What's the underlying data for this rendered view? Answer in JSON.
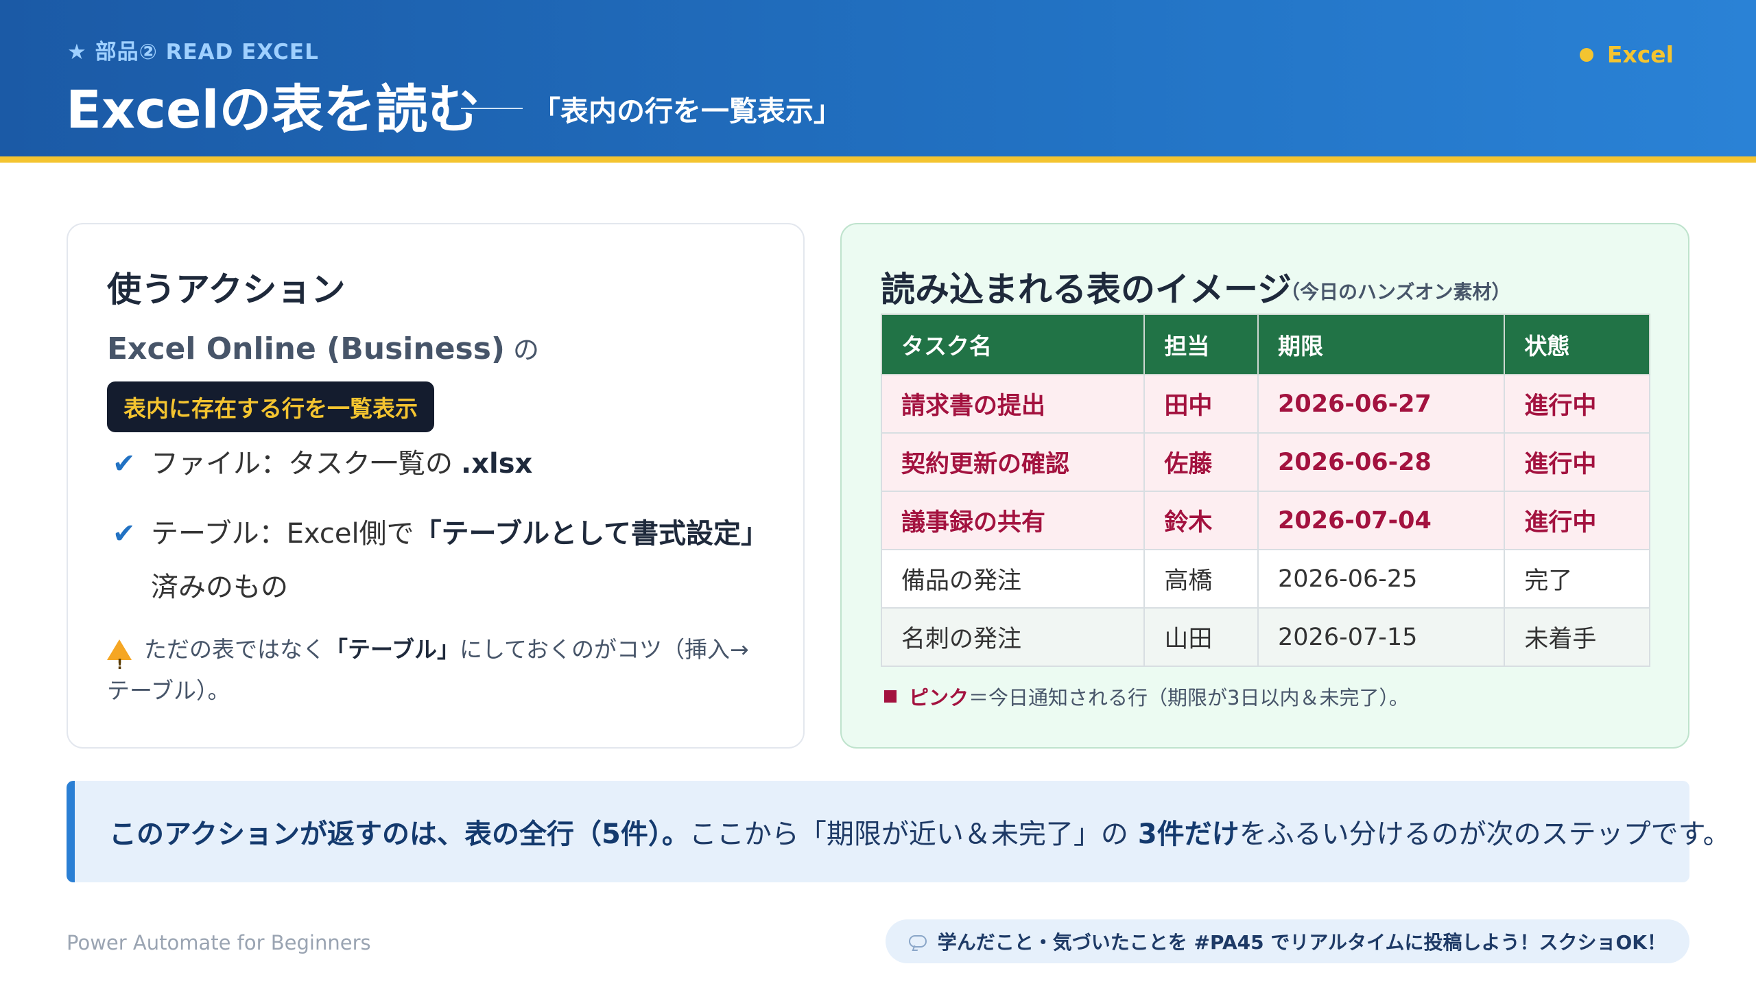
{
  "header": {
    "kicker": "★ 部品② READ EXCEL",
    "title": "Excelの表を読む",
    "subtitle": "「表内の行を一覧表示」",
    "badge": "Excel"
  },
  "left_card": {
    "title": "使うアクション",
    "product": "Excel Online (Business)",
    "product_suffix": "の",
    "action_label": "表内に存在する行を一覧表示",
    "bullets": {
      "file_prefix": "ファイル：タスク一覧の",
      "file_ext": ".xlsx",
      "table_prefix": "テーブル：Excel側で",
      "table_em": "「テーブルとして書式設定」",
      "table_cont": "済みのもの"
    },
    "tip": {
      "text_before": "ただの表ではなく",
      "em": "「テーブル」",
      "text_after": "にしておくのがコツ（挿入→テーブル）。"
    }
  },
  "right_card": {
    "title": "読み込まれる表のイメージ",
    "note": "（今日のハンズオン素材）",
    "columns": [
      "タスク名",
      "担当",
      "期限",
      "状態"
    ],
    "rows": [
      {
        "task": "請求書の提出",
        "owner": "田中",
        "due": "2026-06-27",
        "status": "進行中",
        "highlight": true
      },
      {
        "task": "契約更新の確認",
        "owner": "佐藤",
        "due": "2026-06-28",
        "status": "進行中",
        "highlight": true
      },
      {
        "task": "議事録の共有",
        "owner": "鈴木",
        "due": "2026-07-04",
        "status": "進行中",
        "highlight": true
      },
      {
        "task": "備品の発注",
        "owner": "高橋",
        "due": "2026-06-25",
        "status": "完了",
        "highlight": false
      },
      {
        "task": "名刺の発注",
        "owner": "山田",
        "due": "2026-07-15",
        "status": "未着手",
        "highlight": false
      }
    ],
    "legend": {
      "em": "ピンク",
      "text": "＝今日通知される行（期限が3日以内＆未完了）。"
    }
  },
  "banner": {
    "em1": "このアクションが返すのは、表の全行（5件）。",
    "text1": "ここから「期限が近い＆未完了」の",
    "em2": "3件だけ",
    "text2": "をふるい分けるのが次のステップです。"
  },
  "footer": {
    "left": "Power Automate for Beginners",
    "pill": "学んだこと・気づいたことを #PA45 でリアルタイムに投稿しよう！スクショOK！"
  },
  "colors": {
    "header_blue": "#1b5aa6",
    "accent_yellow": "#f4c430",
    "excel_green": "#217346",
    "highlight_pink": "#fdeef1",
    "highlight_text": "#a3123f"
  },
  "icons": [
    "star-icon",
    "excel-dot-icon",
    "check-icon",
    "warning-icon",
    "legend-square-icon",
    "speech-bubble-icon"
  ]
}
